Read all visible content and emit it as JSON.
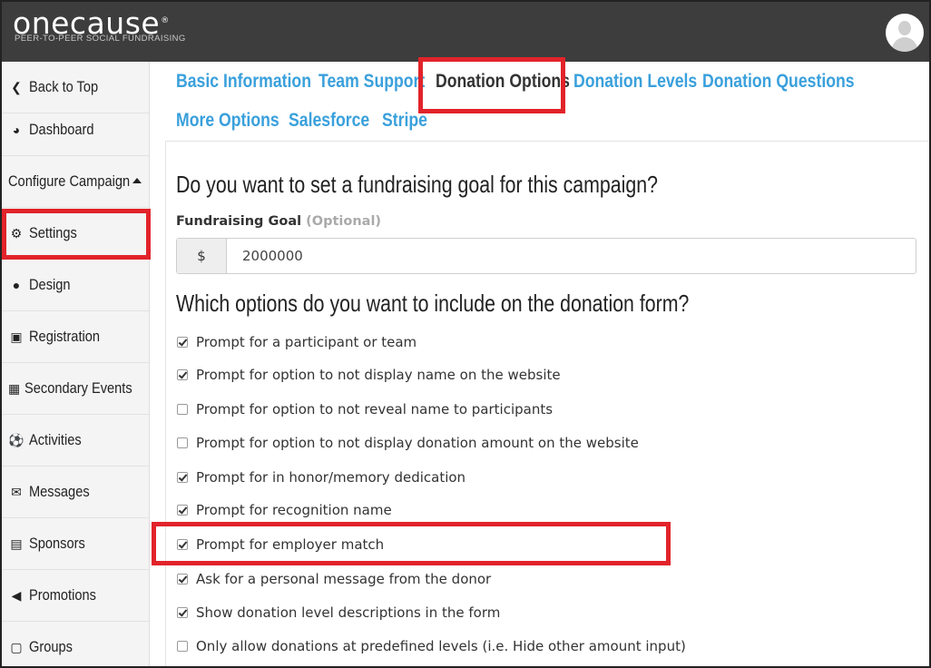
{
  "header": {
    "logo_text": "onecause",
    "logo_mark": "®",
    "tagline": "PEER-TO-PEER SOCIAL FUNDRAISING",
    "avatar_icon": "user-avatar-icon"
  },
  "sidebar": {
    "items": [
      {
        "label": "Back to Top",
        "icon": "chevron-left-icon",
        "glyph": "❮"
      },
      {
        "label": "Dashboard",
        "icon": "dashboard-gauge-icon",
        "glyph": "◕"
      },
      {
        "label": "Configure Campaign",
        "icon": "",
        "glyph": ""
      },
      {
        "label": "Settings",
        "icon": "cogs-icon",
        "glyph": "⚙"
      },
      {
        "label": "Design",
        "icon": "globe-icon",
        "glyph": "●"
      },
      {
        "label": "Registration",
        "icon": "id-card-icon",
        "glyph": "▣"
      },
      {
        "label": "Secondary Events",
        "icon": "calendar-icon",
        "glyph": "▦"
      },
      {
        "label": "Activities",
        "icon": "soccer-ball-icon",
        "glyph": "⚽"
      },
      {
        "label": "Messages",
        "icon": "envelope-icon",
        "glyph": "✉"
      },
      {
        "label": "Sponsors",
        "icon": "gift-icon",
        "glyph": "▤"
      },
      {
        "label": "Promotions",
        "icon": "megaphone-icon",
        "glyph": "◀"
      },
      {
        "label": "Groups",
        "icon": "object-group-icon",
        "glyph": "▢"
      }
    ]
  },
  "tabs": [
    {
      "label": "Basic Information"
    },
    {
      "label": "Team Support"
    },
    {
      "label": "Donation Options"
    },
    {
      "label": "Donation Levels"
    },
    {
      "label": "Donation Questions"
    },
    {
      "label": "More Options"
    },
    {
      "label": "Salesforce"
    },
    {
      "label": "Stripe"
    }
  ],
  "form": {
    "goal_heading": "Do you want to set a fundraising goal for this campaign?",
    "goal_label": "Fundraising Goal",
    "goal_optional": "(Optional)",
    "currency_symbol": "$",
    "goal_value": "2000000",
    "options_heading": "Which options do you want to include on the donation form?",
    "options": [
      {
        "label": "Prompt for a participant or team",
        "checked": true
      },
      {
        "label": "Prompt for option to not display name on the website",
        "checked": true
      },
      {
        "label": "Prompt for option to not reveal name to participants",
        "checked": false
      },
      {
        "label": "Prompt for option to not display donation amount on the website",
        "checked": false
      },
      {
        "label": "Prompt for in honor/memory dedication",
        "checked": true
      },
      {
        "label": "Prompt for recognition name",
        "checked": true
      },
      {
        "label": "Prompt for employer match",
        "checked": true
      },
      {
        "label": "Ask for a personal message from the donor",
        "checked": true
      },
      {
        "label": "Show donation level descriptions in the form",
        "checked": true
      },
      {
        "label": "Only allow donations at predefined levels (i.e. Hide other amount input)",
        "checked": false
      }
    ]
  },
  "colors": {
    "header_bg": "#3d3d3d",
    "tab_link": "#3aa0dc",
    "highlight_red": "#e2232a"
  }
}
